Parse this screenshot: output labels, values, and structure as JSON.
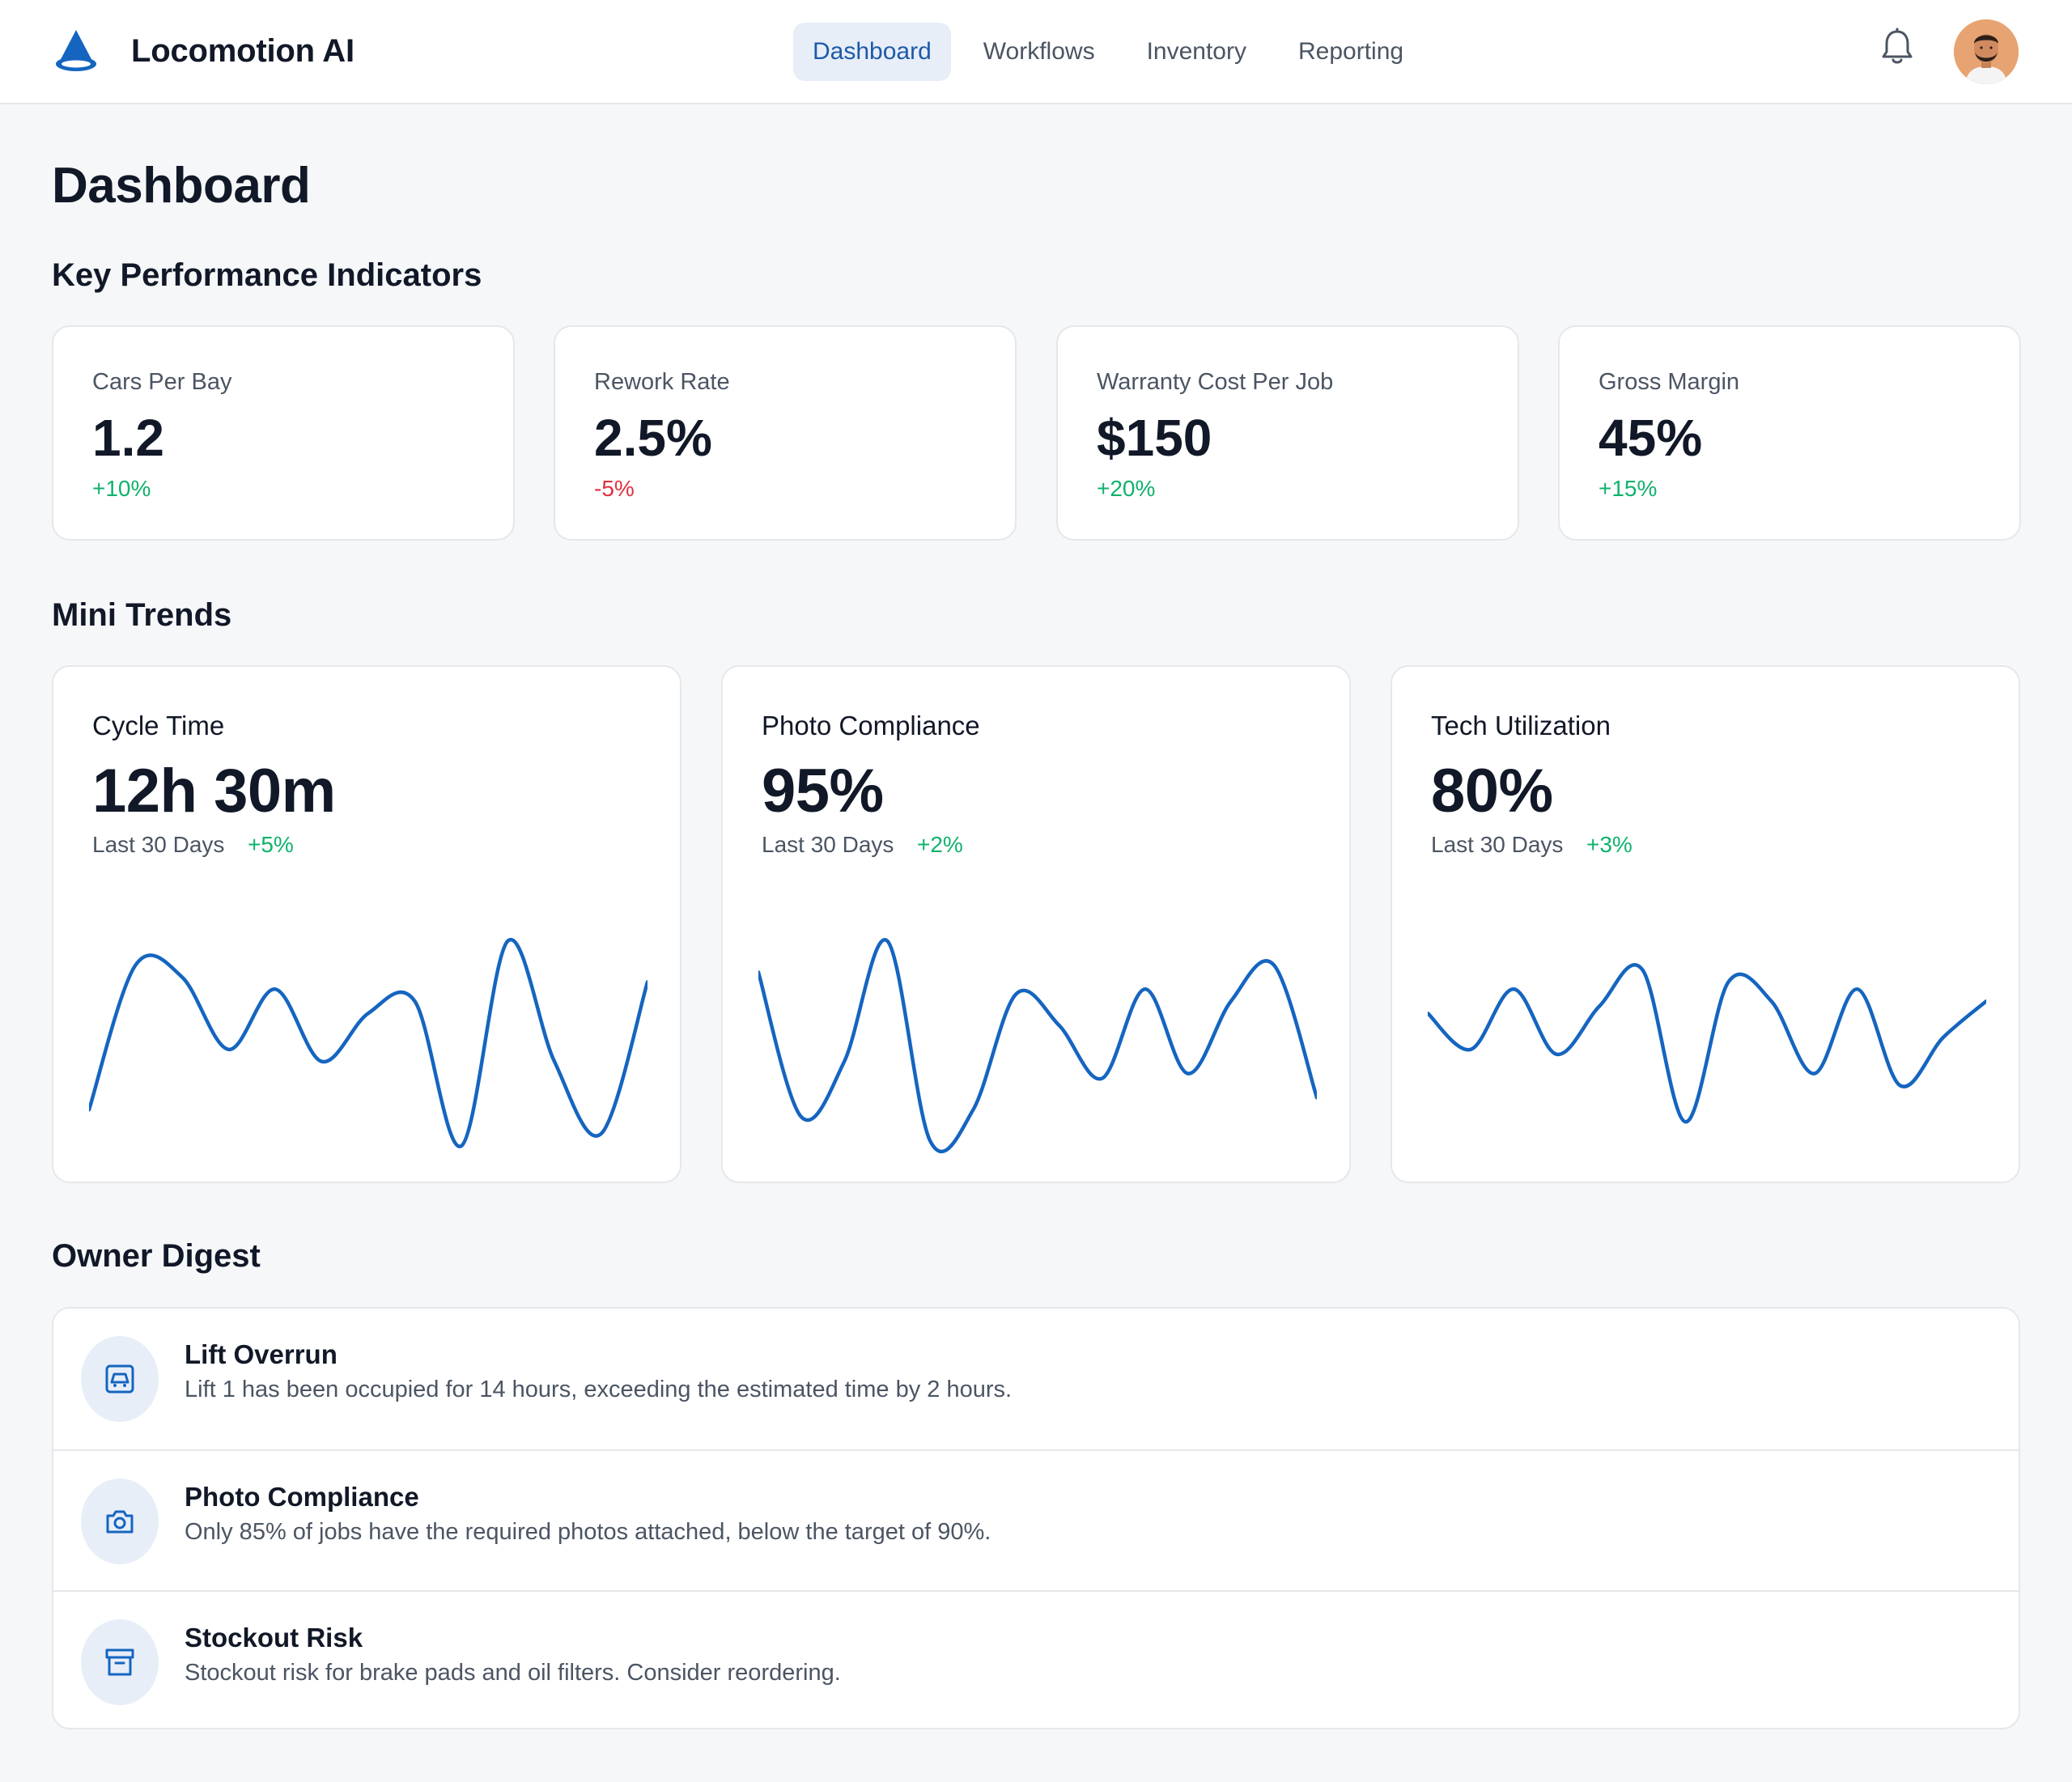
{
  "app": {
    "name": "Locomotion AI",
    "accent": "#1565c0"
  },
  "nav": {
    "tabs": [
      {
        "label": "Dashboard",
        "active": true
      },
      {
        "label": "Workflows",
        "active": false
      },
      {
        "label": "Inventory",
        "active": false
      },
      {
        "label": "Reporting",
        "active": false
      }
    ],
    "icons": [
      "bell-icon",
      "avatar"
    ]
  },
  "page": {
    "title": "Dashboard"
  },
  "sections": {
    "kpi": "Key Performance Indicators",
    "trends": "Mini Trends",
    "digest": "Owner Digest"
  },
  "kpis": [
    {
      "label": "Cars Per Bay",
      "value": "1.2",
      "delta": "+10%",
      "trend": "positive"
    },
    {
      "label": "Rework Rate",
      "value": "2.5%",
      "delta": "-5%",
      "trend": "negative"
    },
    {
      "label": "Warranty Cost Per Job",
      "value": "$150",
      "delta": "+20%",
      "trend": "positive"
    },
    {
      "label": "Gross Margin",
      "value": "45%",
      "delta": "+15%",
      "trend": "positive"
    }
  ],
  "trends": [
    {
      "label": "Cycle Time",
      "value": "12h 30m",
      "period": "Last 30 Days",
      "delta": "+5%",
      "series": [
        15,
        75,
        70,
        40,
        65,
        35,
        55,
        60,
        0,
        85,
        35,
        5,
        68
      ]
    },
    {
      "label": "Photo Compliance",
      "value": "95%",
      "period": "Last 30 Days",
      "delta": "+2%",
      "series": [
        72,
        12,
        35,
        85,
        2,
        15,
        63,
        50,
        28,
        65,
        30,
        60,
        75,
        20
      ]
    },
    {
      "label": "Tech Utilization",
      "value": "80%",
      "period": "Last 30 Days",
      "delta": "+3%",
      "series": [
        55,
        40,
        65,
        38,
        58,
        73,
        10,
        68,
        60,
        30,
        65,
        25,
        45,
        60
      ]
    }
  ],
  "digest": [
    {
      "title": "Lift Overrun",
      "text": "Lift 1 has been occupied for 14 hours, exceeding the estimated time by 2 hours.",
      "icon": "car-icon"
    },
    {
      "title": "Photo Compliance",
      "text": "Only 85% of jobs have the required photos attached, below the target of 90%.",
      "icon": "camera-icon"
    },
    {
      "title": "Stockout Risk",
      "text": "Stockout risk for brake pads and oil filters. Consider reordering.",
      "icon": "archive-icon"
    }
  ],
  "colors": {
    "positive": "#10b26c",
    "negative": "#e0303e",
    "line": "#1565c0"
  }
}
